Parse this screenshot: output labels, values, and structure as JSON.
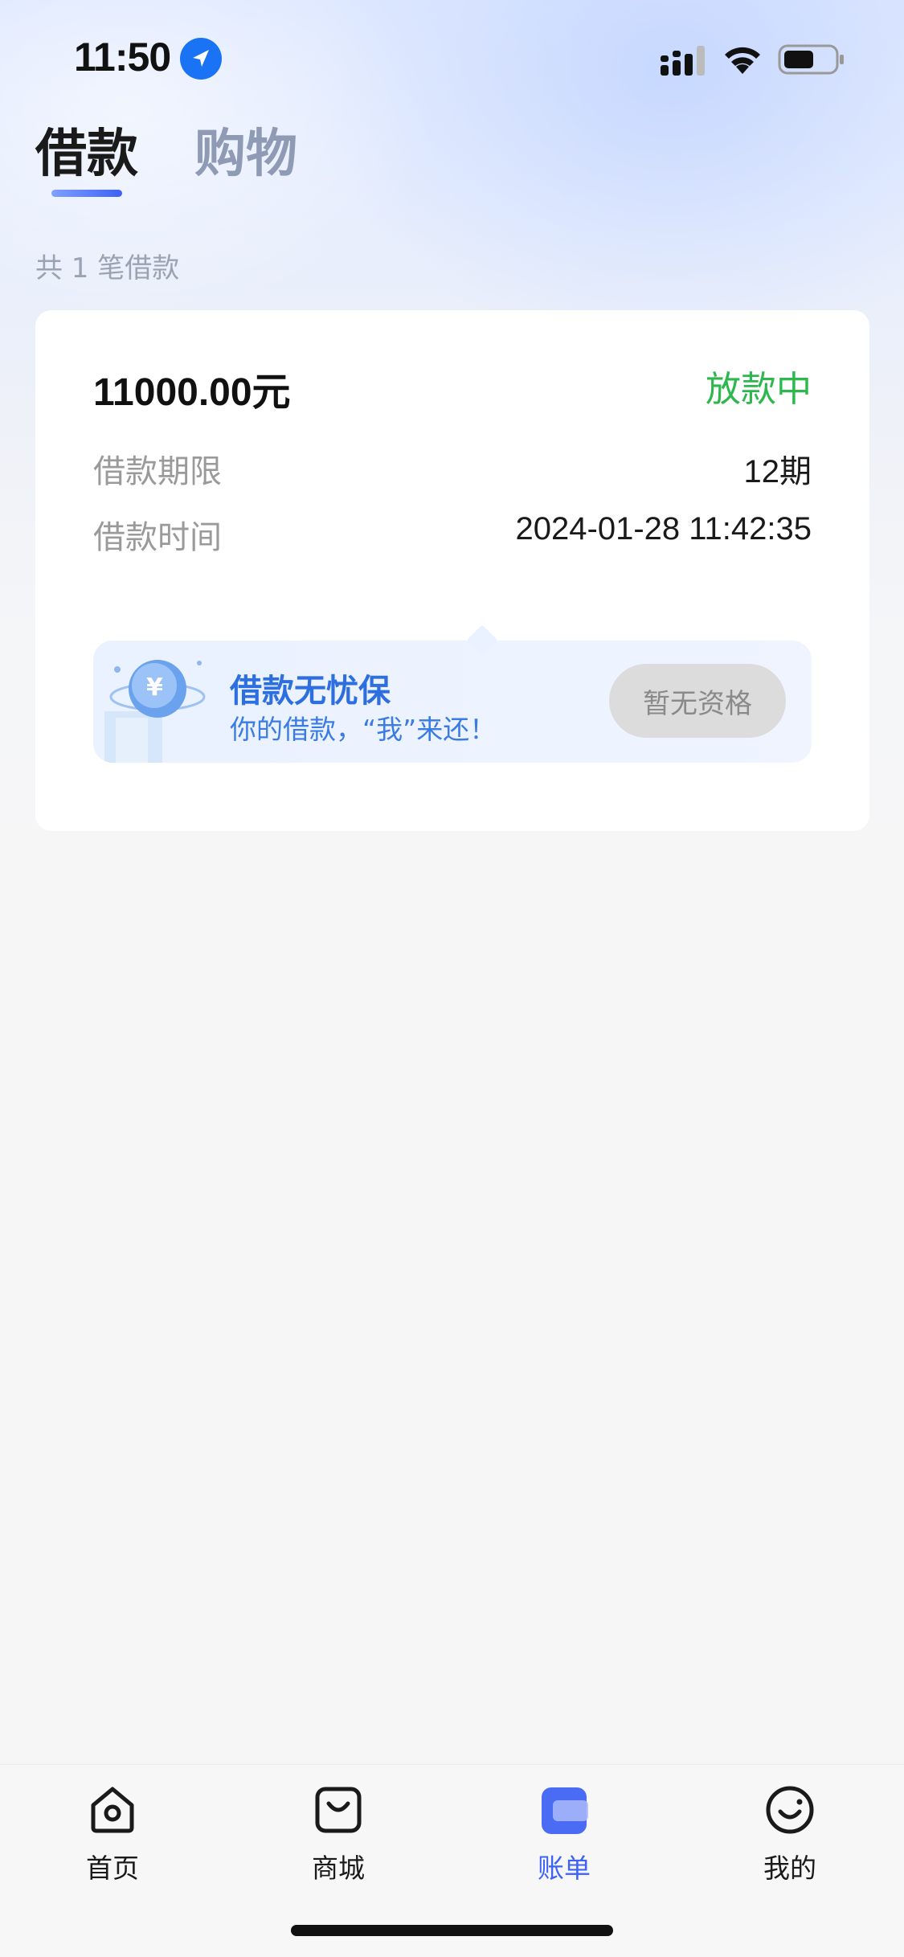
{
  "status_bar": {
    "time": "11:50"
  },
  "tabs": [
    {
      "label": "借款",
      "active": true
    },
    {
      "label": "购物",
      "active": false
    }
  ],
  "loan_count_text": "共 1 笔借款",
  "loan_card": {
    "amount": "11000.00元",
    "status": "放款中",
    "status_color": "#2db84d",
    "rows": [
      {
        "label": "借款期限",
        "value": "12期"
      },
      {
        "label": "借款时间",
        "value": "2024-01-28 11:42:35"
      }
    ],
    "insurance": {
      "title": "借款无忧保",
      "subtitle": "你的借款，“我”来还！",
      "button_label": "暂无资格",
      "accent_color": "#2e6fe0"
    }
  },
  "bottom_nav": [
    {
      "label": "首页",
      "icon": "home-icon",
      "active": false
    },
    {
      "label": "商城",
      "icon": "shopping-bag-icon",
      "active": false
    },
    {
      "label": "账单",
      "icon": "bill-icon",
      "active": true
    },
    {
      "label": "我的",
      "icon": "profile-smile-icon",
      "active": false
    }
  ],
  "colors": {
    "primary": "#3d62f5",
    "tab_inactive": "#8f9bb5"
  }
}
